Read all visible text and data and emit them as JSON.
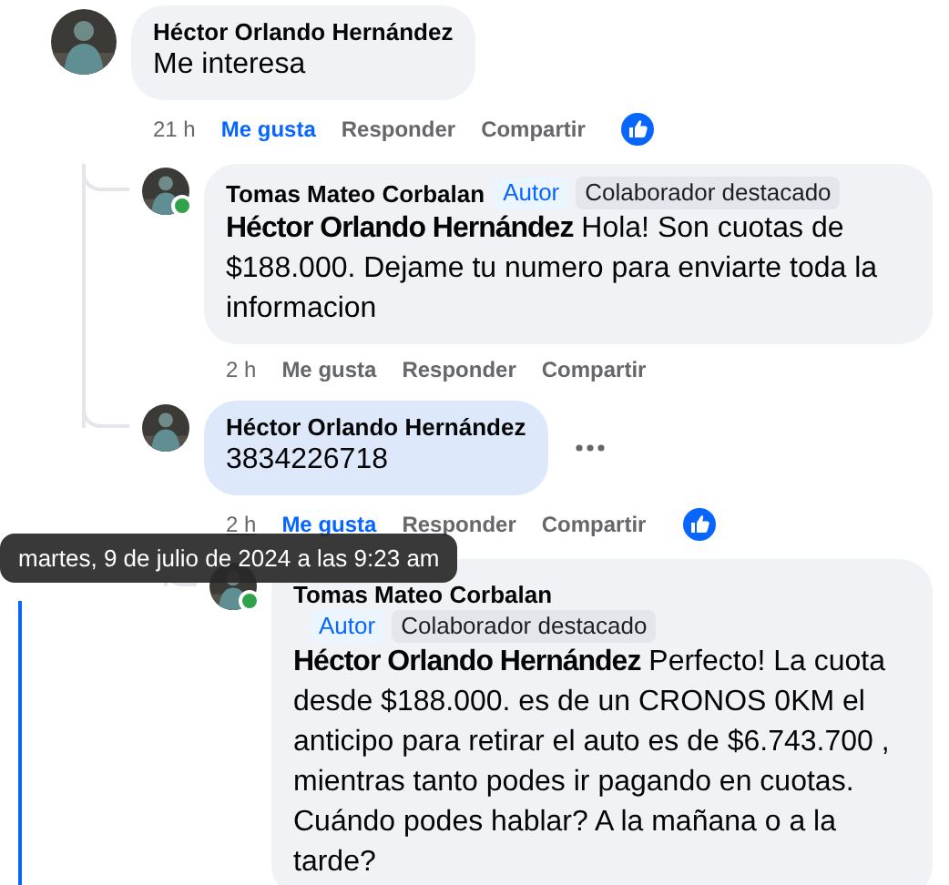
{
  "comments": [
    {
      "author": "Héctor Orlando Hernández",
      "text": "Me interesa",
      "time": "21 h",
      "time_hovered": false,
      "liked": true,
      "highlighted": false,
      "online": false,
      "reaction_icon": true,
      "menu": false,
      "actions": [
        "Me gusta",
        "Responder",
        "Compartir"
      ],
      "children": [
        {
          "author": "Tomas Mateo Corbalan",
          "badges": [
            {
              "label": "Autor",
              "kind": "author"
            },
            {
              "label": "Colaborador destacado",
              "kind": "top_contributor"
            }
          ],
          "text": "**Héctor Orlando Hernández** Hola! Son cuotas de $188.000. Dejame tu numero para enviarte toda la informacion",
          "time": "2 h",
          "time_hovered": false,
          "liked": false,
          "highlighted": false,
          "online": true,
          "reaction_icon": false,
          "menu": false,
          "actions": [
            "Me gusta",
            "Responder",
            "Compartir"
          ]
        },
        {
          "author": "Héctor Orlando Hernández",
          "text": "3834226718",
          "time": "2 h",
          "time_hovered": true,
          "liked": true,
          "highlighted": true,
          "online": false,
          "reaction_icon": true,
          "menu": true,
          "actions": [
            "Me gusta",
            "Responder",
            "Compartir"
          ],
          "children": [
            {
              "author": "Tomas Mateo Corbalan",
              "badges": [
                {
                  "label": "Autor",
                  "kind": "author"
                },
                {
                  "label": "Colaborador destacado",
                  "kind": "top_contributor"
                }
              ],
              "text": "**Héctor Orlando Hernández** Perfecto! La cuota desde $188.000. es de un CRONOS 0KM el anticipo para retirar el auto es de $6.743.700 , mientras tanto podes ir pagando en cuotas. Cuándo podes hablar? A la mañana o a la tarde?",
              "online": true,
              "highlighted": false,
              "menu": false,
              "wrap_badges": true
            }
          ]
        }
      ]
    }
  ],
  "tooltip": {
    "text": "martes, 9 de julio de 2024 a las 9:23 am"
  }
}
